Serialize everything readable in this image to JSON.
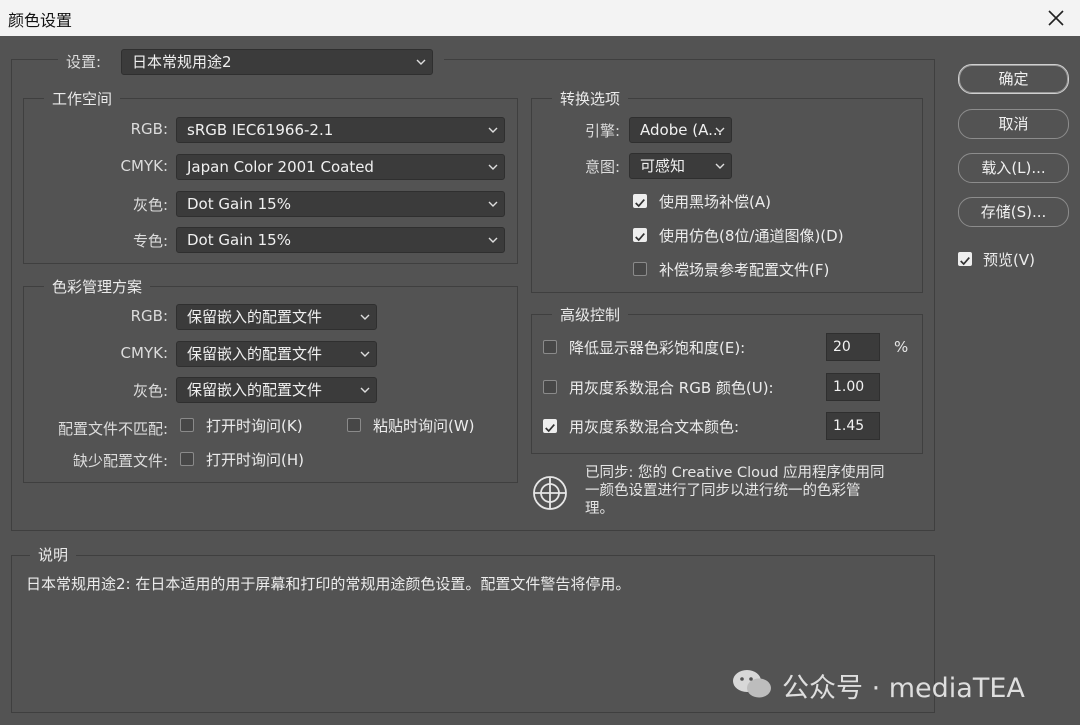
{
  "window": {
    "title": "颜色设置"
  },
  "settings": {
    "label": "设置:",
    "value": "日本常规用途2"
  },
  "workspace": {
    "title": "工作空间",
    "rows": [
      {
        "label": "RGB:",
        "value": "sRGB IEC61966-2.1"
      },
      {
        "label": "CMYK:",
        "value": "Japan Color 2001 Coated"
      },
      {
        "label": "灰色:",
        "value": "Dot Gain 15%"
      },
      {
        "label": "专色:",
        "value": "Dot Gain 15%"
      }
    ]
  },
  "policies": {
    "title": "色彩管理方案",
    "rows": [
      {
        "label": "RGB:",
        "value": "保留嵌入的配置文件"
      },
      {
        "label": "CMYK:",
        "value": "保留嵌入的配置文件"
      },
      {
        "label": "灰色:",
        "value": "保留嵌入的配置文件"
      }
    ],
    "mismatch_label": "配置文件不匹配:",
    "mismatch_open": {
      "label": "打开时询问(K)",
      "checked": false
    },
    "mismatch_paste": {
      "label": "粘贴时询问(W)",
      "checked": false
    },
    "missing_label": "缺少配置文件:",
    "missing_open": {
      "label": "打开时询问(H)",
      "checked": false
    }
  },
  "conversion": {
    "title": "转换选项",
    "engine_label": "引擎:",
    "engine_value": "Adobe (A...",
    "intent_label": "意图:",
    "intent_value": "可感知",
    "black_point": {
      "label": "使用黑场补偿(A)",
      "checked": true
    },
    "dither": {
      "label": "使用仿色(8位/通道图像)(D)",
      "checked": true
    },
    "compensate": {
      "label": "补偿场景参考配置文件(F)",
      "checked": false
    }
  },
  "advanced": {
    "title": "高级控制",
    "desaturate": {
      "label": "降低显示器色彩饱和度(E):",
      "checked": false,
      "value": "20",
      "unit": "%"
    },
    "blend_rgb": {
      "label": "用灰度系数混合 RGB 颜色(U):",
      "checked": false,
      "value": "1.00"
    },
    "blend_text": {
      "label": "用灰度系数混合文本颜色:",
      "checked": true,
      "value": "1.45"
    }
  },
  "sync": {
    "icon": "sync-target-icon",
    "line1": "已同步: 您的 Creative Cloud 应用程序使用同",
    "line2": "一颜色设置进行了同步以进行统一的色彩管",
    "line3": "理。"
  },
  "description": {
    "title": "说明",
    "text": "日本常规用途2: 在日本适用的用于屏幕和打印的常规用途颜色设置。配置文件警告将停用。"
  },
  "buttons": {
    "ok": "确定",
    "cancel": "取消",
    "load": "载入(L)...",
    "save": "存储(S)...",
    "preview": {
      "label": "预览(V)",
      "checked": true
    }
  },
  "watermark": {
    "text": "公众号 · mediaTEA"
  },
  "colors": {
    "background": "#535353",
    "field": "#3b3b3b",
    "titlebar": "#f3f3f3"
  }
}
